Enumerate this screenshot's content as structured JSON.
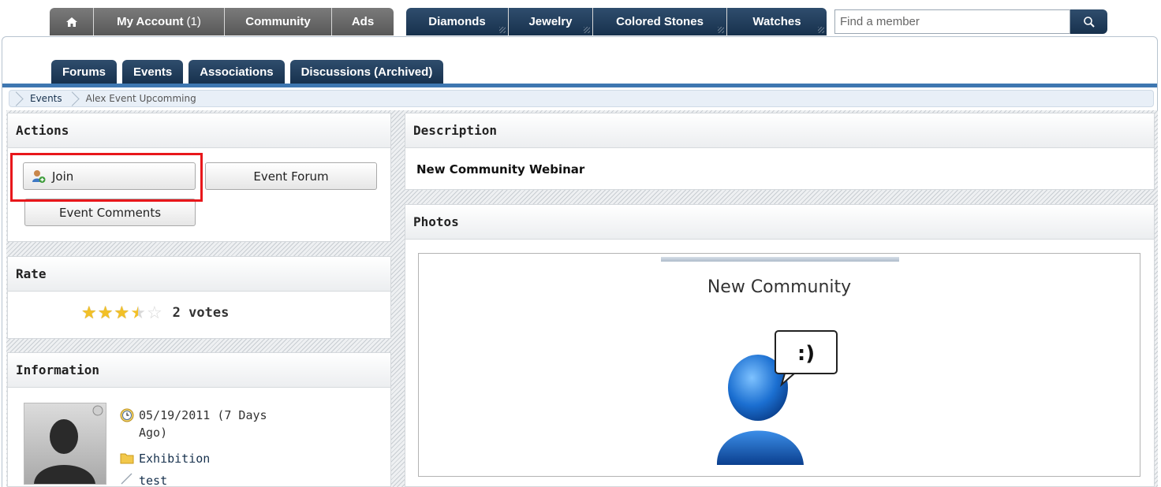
{
  "topnav": {
    "home_label": "",
    "my_account": "My Account",
    "my_account_count": "(1)",
    "community": "Community",
    "ads": "Ads",
    "diamonds": "Diamonds",
    "jewelry": "Jewelry",
    "colored_stones": "Colored Stones",
    "watches": "Watches",
    "search_placeholder": "Find a member"
  },
  "subnav": {
    "tabs": [
      "Forums",
      "Events",
      "Associations",
      "Discussions (Archived)"
    ]
  },
  "breadcrumb": {
    "items": [
      "Events",
      "Alex Event Upcomming"
    ]
  },
  "actions": {
    "title": "Actions",
    "join": "Join",
    "event_forum": "Event Forum",
    "event_comments": "Event Comments"
  },
  "rate": {
    "title": "Rate",
    "rating": 3.5,
    "max": 5,
    "votes": "2 votes"
  },
  "information": {
    "title": "Information",
    "date": "05/19/2011 (7 Days",
    "date_suffix": "Ago)",
    "category": "Exhibition",
    "tag": "test"
  },
  "description": {
    "title": "Description",
    "body": "New Community Webinar"
  },
  "photos": {
    "title": "Photos",
    "slide_title": "New Community",
    "bubble_text": ":)"
  },
  "colors": {
    "nav_blue": "#17314d",
    "nav_gray": "#585858",
    "highlight": "#e8171b",
    "star": "#f2c027"
  }
}
